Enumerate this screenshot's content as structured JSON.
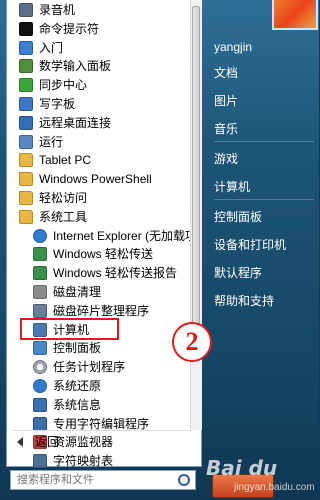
{
  "menu": {
    "items": [
      {
        "label": "录音机",
        "icon": "microphone-icon",
        "type": "app",
        "indent": 0,
        "color": "#5a6f86"
      },
      {
        "label": "命令提示符",
        "icon": "command-prompt-icon",
        "type": "app",
        "indent": 0,
        "color": "#111111"
      },
      {
        "label": "入门",
        "icon": "getting-started-icon",
        "type": "app",
        "indent": 0,
        "color": "#3d7fd0"
      },
      {
        "label": "数学输入面板",
        "icon": "math-input-icon",
        "type": "app",
        "indent": 0,
        "color": "#4f8f3a"
      },
      {
        "label": "同步中心",
        "icon": "sync-center-icon",
        "type": "app",
        "indent": 0,
        "color": "#3aa63a"
      },
      {
        "label": "写字板",
        "icon": "wordpad-icon",
        "type": "app",
        "indent": 0,
        "color": "#3a78c8"
      },
      {
        "label": "远程桌面连接",
        "icon": "remote-desktop-icon",
        "type": "app",
        "indent": 0,
        "color": "#2f6fb8"
      },
      {
        "label": "运行",
        "icon": "run-icon",
        "type": "app",
        "indent": 0,
        "color": "#5a86c2"
      },
      {
        "label": "Tablet PC",
        "icon": "folder-icon",
        "type": "folder",
        "indent": 0,
        "color": "#e8b741"
      },
      {
        "label": "Windows PowerShell",
        "icon": "folder-icon",
        "type": "folder",
        "indent": 0,
        "color": "#e8b741"
      },
      {
        "label": "轻松访问",
        "icon": "folder-icon",
        "type": "folder",
        "indent": 0,
        "color": "#e8b741"
      },
      {
        "label": "系统工具",
        "icon": "folder-icon",
        "type": "folder",
        "indent": 0,
        "color": "#e8b741"
      },
      {
        "label": "Internet Explorer (无加载项)",
        "icon": "internet-explorer-icon",
        "type": "app",
        "indent": 1,
        "color": "#2e7bd3"
      },
      {
        "label": "Windows 轻松传送",
        "icon": "easy-transfer-icon",
        "type": "app",
        "indent": 1,
        "color": "#3a8f4a"
      },
      {
        "label": "Windows 轻松传送报告",
        "icon": "easy-transfer-report-icon",
        "type": "app",
        "indent": 1,
        "color": "#3a8f4a"
      },
      {
        "label": "磁盘清理",
        "icon": "disk-cleanup-icon",
        "type": "app",
        "indent": 1,
        "color": "#8a8a8a"
      },
      {
        "label": "磁盘碎片整理程序",
        "icon": "defragmenter-icon",
        "type": "app",
        "indent": 1,
        "color": "#6b7f94"
      },
      {
        "label": "计算机",
        "icon": "computer-icon",
        "type": "app",
        "indent": 1,
        "color": "#4a78b0"
      },
      {
        "label": "控制面板",
        "icon": "control-panel-icon",
        "type": "app",
        "indent": 1,
        "color": "#4a88c8"
      },
      {
        "label": "任务计划程序",
        "icon": "task-scheduler-icon",
        "type": "app",
        "indent": 1,
        "color": "#9aa6b2",
        "highlighted": true
      },
      {
        "label": "系统还原",
        "icon": "system-restore-icon",
        "type": "app",
        "indent": 1,
        "color": "#2f7bd0"
      },
      {
        "label": "系统信息",
        "icon": "system-info-icon",
        "type": "app",
        "indent": 1,
        "color": "#3a6fb0"
      },
      {
        "label": "专用字符编辑程序",
        "icon": "private-character-editor-icon",
        "type": "app",
        "indent": 1,
        "color": "#3f6fa8"
      },
      {
        "label": "资源监视器",
        "icon": "resource-monitor-icon",
        "type": "app",
        "indent": 1,
        "color": "#c84040"
      },
      {
        "label": "字符映射表",
        "icon": "character-map-icon",
        "type": "app",
        "indent": 1,
        "color": "#4d6e95"
      }
    ],
    "back_label": "返回",
    "search_placeholder": "搜索程序和文件"
  },
  "right_panel": {
    "user": "yangjin",
    "items": [
      "文档",
      "图片",
      "音乐",
      "游戏",
      "计算机",
      "控制面板",
      "设备和打印机",
      "默认程序",
      "帮助和支持"
    ]
  },
  "annotation": {
    "step": "2"
  },
  "watermark": {
    "line1": "Bai du",
    "line2": "jingyan.baidu.com"
  }
}
